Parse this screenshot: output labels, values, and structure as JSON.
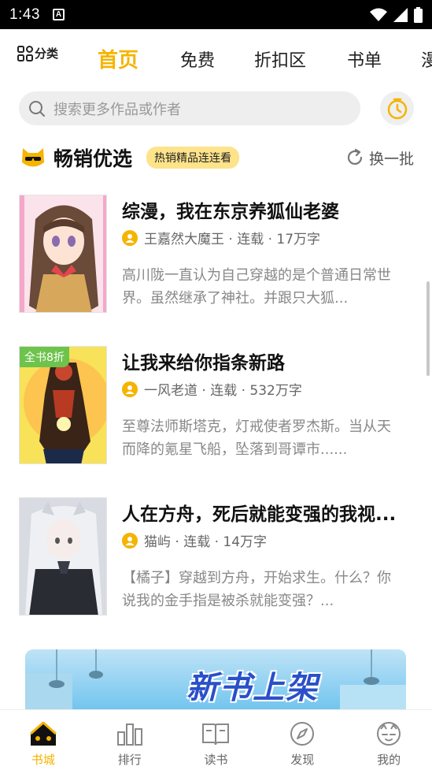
{
  "status_bar": {
    "time": "1:43",
    "notif_letter": "A"
  },
  "top_nav": {
    "category_label": "分类",
    "tabs": [
      {
        "label": "首页",
        "active": true
      },
      {
        "label": "免费"
      },
      {
        "label": "折扣区"
      },
      {
        "label": "书单"
      },
      {
        "label": "漫"
      }
    ]
  },
  "search": {
    "placeholder": "搜索更多作品或作者"
  },
  "section": {
    "title": "畅销优选",
    "badge": "热销精品连连看",
    "refresh_label": "换一批"
  },
  "books": [
    {
      "title": "综漫，我在东京养狐仙老婆",
      "meta": "王嘉然大魔王 · 连载 · 17万字",
      "desc": "高川陇一直认为自己穿越的是个普通日常世界。虽然继承了神社。并跟只大狐...",
      "badge": ""
    },
    {
      "title": "让我来给你指条新路",
      "meta": "一风老道 · 连载 · 532万字",
      "desc": "至尊法师斯塔克，灯戒使者罗杰斯。当从天而降的氪星飞船，坠落到哥谭市......",
      "badge": "全书8折"
    },
    {
      "title": "人在方舟，死后就能变强的我视...",
      "meta": "猫屿 · 连载 · 14万字",
      "desc": "【橘子】穿越到方舟，开始求生。什么？你说我的金手指是被杀就能变强？...",
      "badge": ""
    }
  ],
  "banner": {
    "text": "新书上架"
  },
  "bottom_nav": [
    {
      "label": "书城",
      "icon": "bookstore-icon",
      "active": true
    },
    {
      "label": "排行",
      "icon": "ranking-icon"
    },
    {
      "label": "读书",
      "icon": "book-icon"
    },
    {
      "label": "发现",
      "icon": "compass-icon"
    },
    {
      "label": "我的",
      "icon": "cat-profile-icon"
    }
  ],
  "colors": {
    "accent": "#f5b400",
    "badge_bg": "#fde38a",
    "discount_badge": "#6dc34c"
  }
}
